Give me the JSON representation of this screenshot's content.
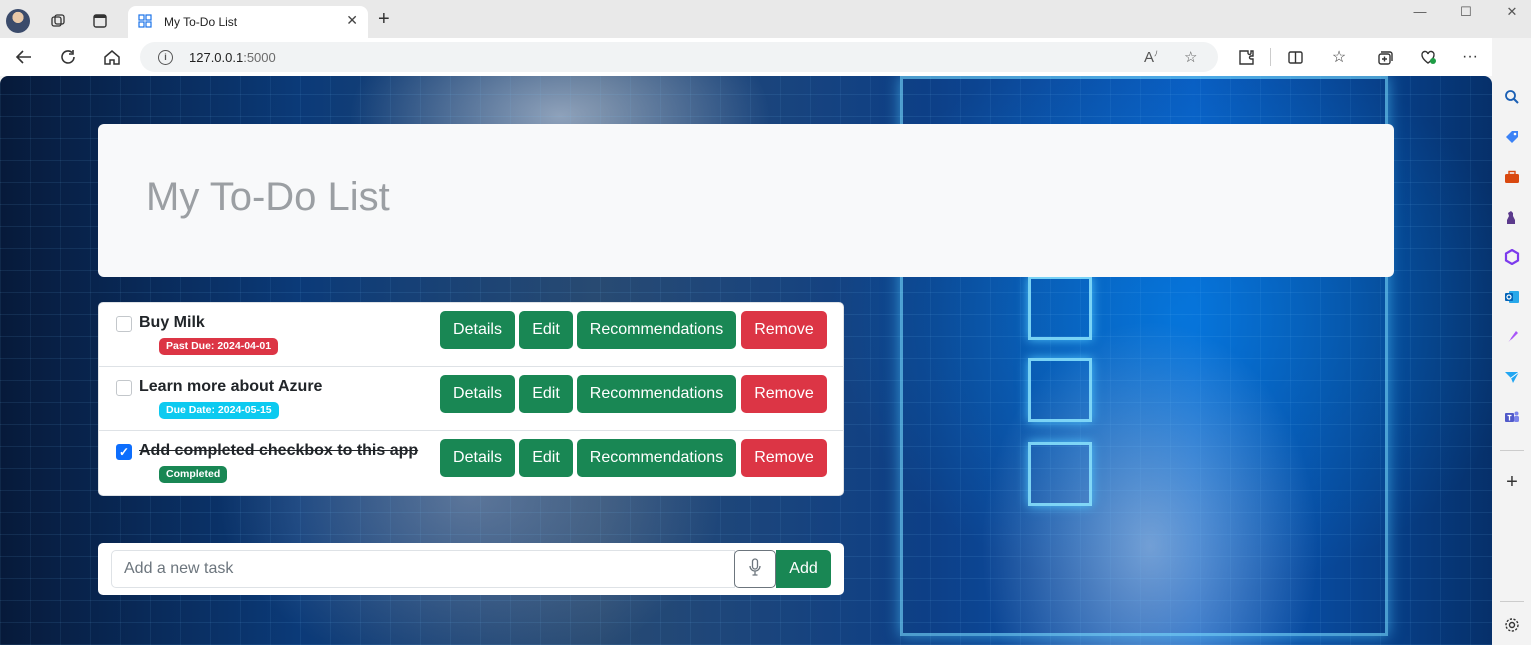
{
  "browser": {
    "tab_title": "My To-Do List",
    "url_host": "127.0.0.1",
    "url_port": ":5000",
    "new_tab_glyph": "+",
    "close_glyph": "✕"
  },
  "app": {
    "title": "My To-Do List",
    "tasks": [
      {
        "name": "Buy Milk",
        "badge": "Past Due: 2024-04-01",
        "badge_color": "#dc3545",
        "completed": false
      },
      {
        "name": "Learn more about Azure",
        "badge": "Due Date: 2024-05-15",
        "badge_color": "#0dcaf0",
        "completed": false
      },
      {
        "name": "Add completed checkbox to this app",
        "badge": "Completed",
        "badge_color": "#198754",
        "completed": true
      }
    ],
    "buttons": {
      "details": "Details",
      "edit": "Edit",
      "recommendations": "Recommendations",
      "remove": "Remove"
    },
    "add_form": {
      "placeholder": "Add a new task",
      "add_label": "Add"
    }
  },
  "colors": {
    "success": "#198754",
    "danger": "#dc3545",
    "info": "#0dcaf0",
    "primary": "#0d6efd"
  }
}
